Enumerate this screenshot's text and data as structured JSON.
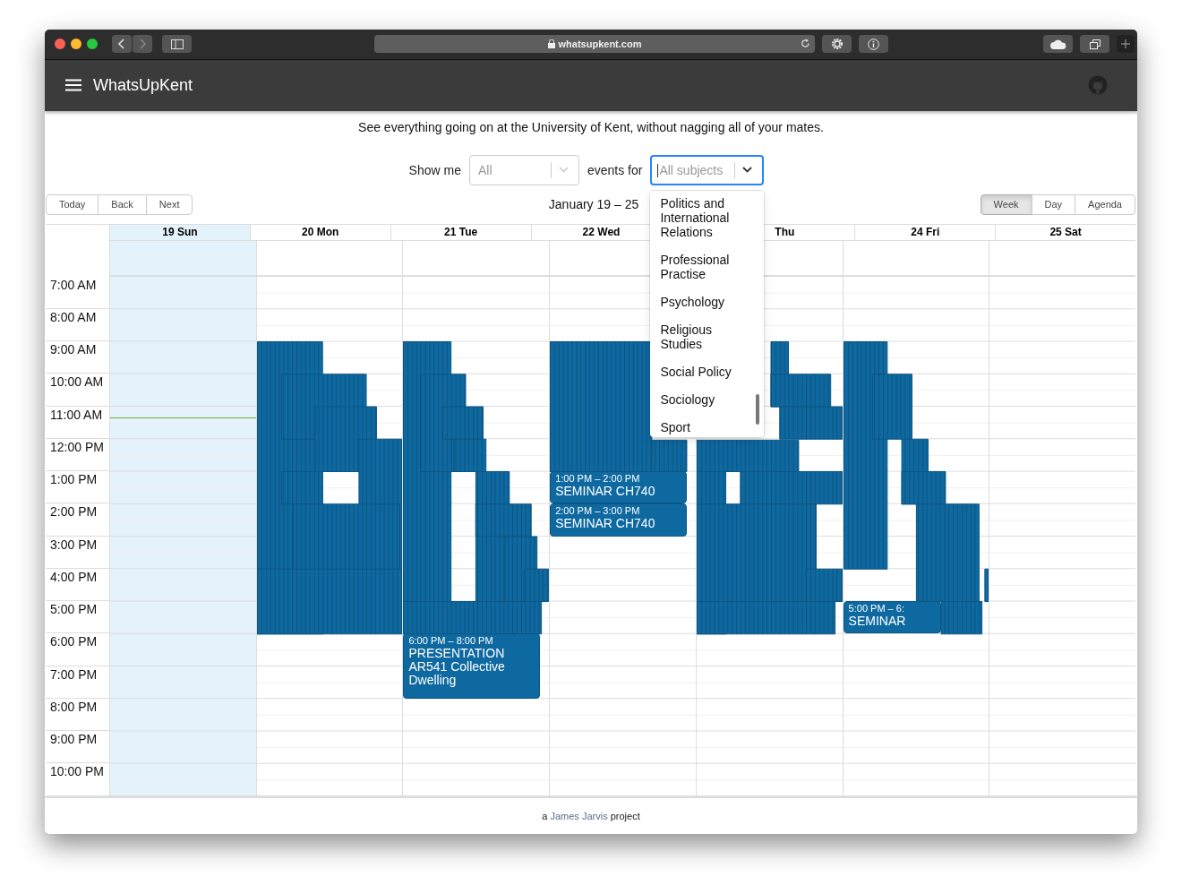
{
  "browser": {
    "url": "whatsupkent.com"
  },
  "app": {
    "title": "WhatsUpKent"
  },
  "tagline": "See everything going on at the University of Kent, without nagging all of your mates.",
  "filters": {
    "label_before": "Show me",
    "type_select": {
      "value": "All"
    },
    "label_between": "events for",
    "subject_select": {
      "placeholder": "All subjects",
      "focused": true,
      "open": true,
      "options": [
        "Politics and International Relations",
        "Professional Practise",
        "Psychology",
        "Religious Studies",
        "Social Policy",
        "Sociology",
        "Sport"
      ]
    }
  },
  "toolbar": {
    "nav_buttons": [
      "Today",
      "Back",
      "Next"
    ],
    "range": "January 19 – 25",
    "views": [
      {
        "label": "Week",
        "selected": true
      },
      {
        "label": "Day",
        "selected": false
      },
      {
        "label": "Agenda",
        "selected": false
      }
    ]
  },
  "time_slots": [
    "7:00 AM",
    "8:00 AM",
    "9:00 AM",
    "10:00 AM",
    "11:00 AM",
    "12:00 PM",
    "1:00 PM",
    "2:00 PM",
    "3:00 PM",
    "4:00 PM",
    "5:00 PM",
    "6:00 PM",
    "7:00 PM",
    "8:00 PM",
    "9:00 PM",
    "10:00 PM"
  ],
  "days": [
    {
      "label": "19 Sun",
      "today": true
    },
    {
      "label": "20 Mon",
      "today": false,
      "overlapping_events": true
    },
    {
      "label": "21 Tue",
      "today": false,
      "overlapping_events": true,
      "events": [
        {
          "time": "6:00 PM – 8:00 PM",
          "title": "PRESENTATION AR541 Collective Dwelling"
        }
      ]
    },
    {
      "label": "22 Wed",
      "today": false,
      "overlapping_events": true,
      "events": [
        {
          "time": "1:00 PM – 2:00 PM",
          "title": "SEMINAR CH740"
        },
        {
          "time": "2:00 PM – 3:00 PM",
          "title": "SEMINAR CH740"
        }
      ]
    },
    {
      "label": "Thu",
      "today": false,
      "overlapping_events": true
    },
    {
      "label": "24 Fri",
      "today": false,
      "overlapping_events": true,
      "events": [
        {
          "time": "5:00 PM – 6:",
          "title": "SEMINAR"
        }
      ]
    },
    {
      "label": "25 Sat",
      "today": false
    }
  ],
  "footer": {
    "prefix": "a",
    "link": "James Jarvis",
    "suffix": "project"
  }
}
